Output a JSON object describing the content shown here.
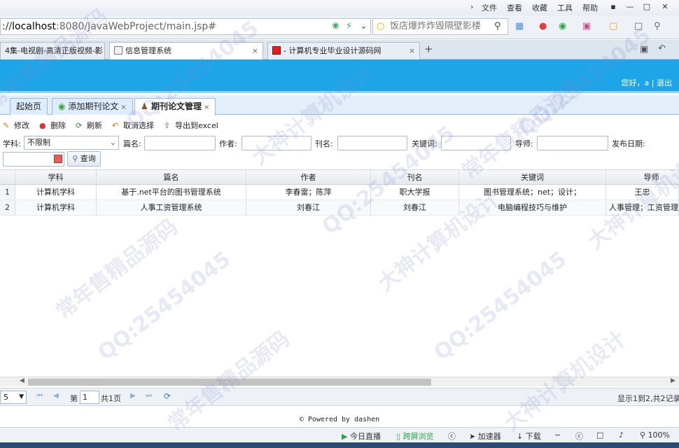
{
  "browser": {
    "menu": [
      "文件",
      "查看",
      "收藏",
      "工具",
      "帮助"
    ],
    "url_prefix": "://",
    "url_host": "localhost",
    "url_rest": ":8080/JavaWebProject/main.jsp#",
    "search_placeholder": "饭店爆炸炸毁隔壁影楼",
    "tabs": [
      {
        "label": "4集-电视剧-高清正版视频-影",
        "close": "×"
      },
      {
        "label": "信息管理系统",
        "close": "×"
      },
      {
        "label": "- 计算机专业毕业设计源码网",
        "close": "×"
      }
    ],
    "new_tab": "+"
  },
  "header": {
    "greeting": "您好，a",
    "separator": "|",
    "logout": "退出"
  },
  "app_tabs": [
    {
      "label": "起始页",
      "closable": false
    },
    {
      "label": "添加期刊论文",
      "closable": true
    },
    {
      "label": "期刊论文管理",
      "closable": true
    }
  ],
  "tab_close": "×",
  "toolbar": {
    "edit": "修改",
    "delete": "删除",
    "refresh": "刷新",
    "cancel_select": "取消选择",
    "export": "导出到excel"
  },
  "search": {
    "subject_label": "学科:",
    "subject_value": "不限制",
    "title_label": "篇名:",
    "author_label": "作者:",
    "journal_label": "刊名:",
    "keyword_label": "关键词:",
    "advisor_label": "导师:",
    "date_label": "发布日期:",
    "query_button": "查询"
  },
  "grid": {
    "columns": [
      "学科",
      "篇名",
      "作者",
      "刊名",
      "关键词",
      "导师"
    ],
    "rows": [
      {
        "num": "1",
        "cells": [
          "计算机学科",
          "基于.net平台的图书管理系统",
          "李春雷；陈萍",
          "职大学报",
          "图书管理系统；net；设计；",
          "王忠"
        ]
      },
      {
        "num": "2",
        "cells": [
          "计算机学科",
          "人事工资管理系统",
          "刘春江",
          "刘春江",
          "电脑编程技巧与维护",
          "人事管理；工资管理"
        ]
      }
    ]
  },
  "pager": {
    "page_size": "5",
    "page_prefix": "第",
    "page_value": "1",
    "page_total": "共1页",
    "summary": "显示1到2,共2记录"
  },
  "footer": {
    "text": "© Powered by dashen"
  },
  "statusbar": {
    "live": "今日直播",
    "split_view": "跨屏浏览",
    "accelerator": "加速器",
    "download": "下载",
    "zoom": "100%"
  },
  "watermark": [
    "常年售精品源码",
    "QQ:25454045",
    "大神计算机设计"
  ],
  "colors": {
    "header_blue": "#1ea5e9",
    "tab_border": "#99bbe8"
  }
}
